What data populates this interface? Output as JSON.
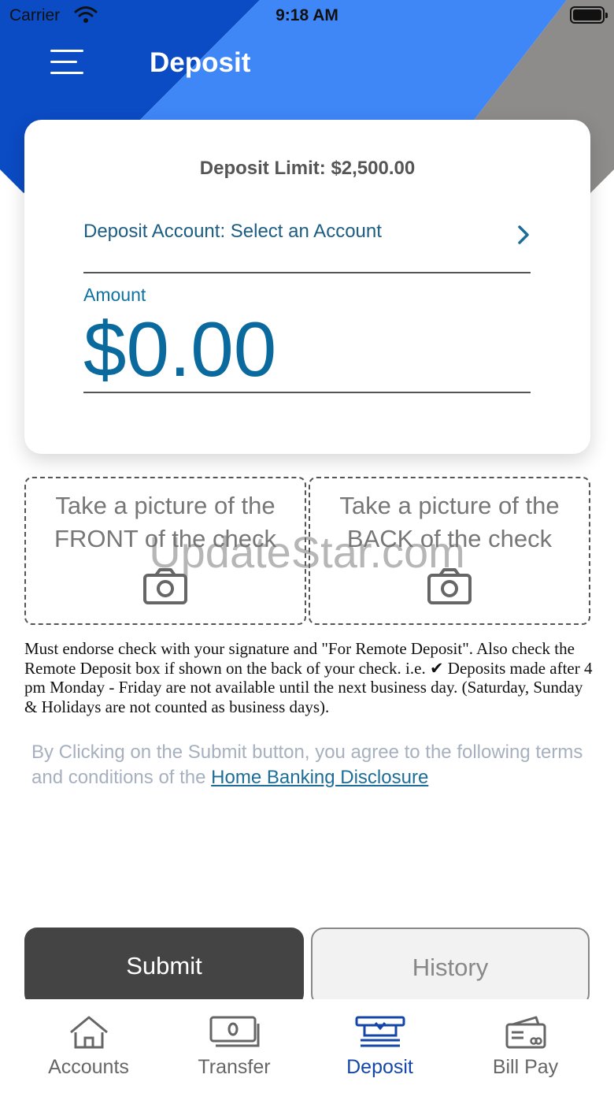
{
  "colors": {
    "header_blue_dark": "#0b4bc4",
    "header_blue_light": "#3f86f7",
    "header_gray": "#8e8b8b",
    "accent_text": "#0a6a9e",
    "active_tab": "#1446a8",
    "submit_bg": "#444444"
  },
  "status_bar": {
    "carrier": "Carrier",
    "time": "9:18 AM"
  },
  "header": {
    "menu_icon": "hamburger-menu-icon",
    "title": "Deposit"
  },
  "card": {
    "deposit_limit": "Deposit Limit:  $2,500.00",
    "deposit_account": "Deposit Account: Select an Account",
    "amount_label": "Amount",
    "amount_value": "$0.00"
  },
  "capture": {
    "front_label": "Take a picture of the FRONT of the check",
    "back_label": "Take a picture of the BACK of the check",
    "icon": "camera-icon"
  },
  "watermark": "UpdateStar.com",
  "notice": "Must endorse check with your signature and \"For Remote Deposit\". Also check the Remote Deposit box if shown on the back of your check. i.e. ✔ Deposits made after 4 pm Monday - Friday are not available until the next business day. (Saturday, Sunday & Holidays are not counted as business days).",
  "agreement": {
    "text": "By Clicking on the Submit button, you agree to the following terms and conditions of the ",
    "link": "Home Banking Disclosure"
  },
  "actions": {
    "submit_label": "Submit",
    "history_label": "History"
  },
  "tabs": [
    {
      "label": "Accounts",
      "icon": "home-icon"
    },
    {
      "label": "Transfer",
      "icon": "transfer-cash-icon"
    },
    {
      "label": "Deposit",
      "icon": "deposit-icon",
      "active": true
    },
    {
      "label": "Bill Pay",
      "icon": "bill-pay-card-icon"
    }
  ]
}
